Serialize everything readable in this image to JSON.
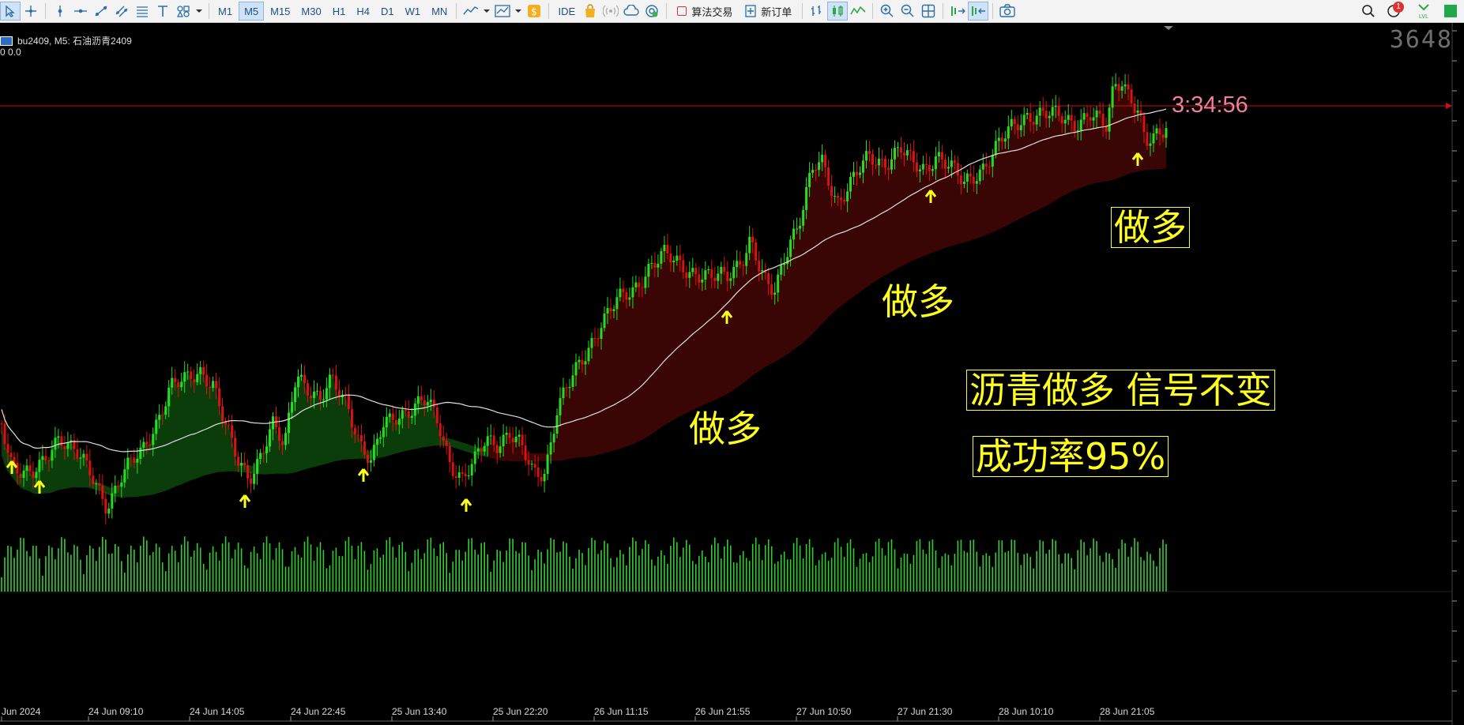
{
  "toolbar": {
    "timeframes": [
      {
        "label": "M1",
        "active": false
      },
      {
        "label": "M5",
        "active": true
      },
      {
        "label": "M15",
        "active": false
      },
      {
        "label": "M30",
        "active": false
      },
      {
        "label": "H1",
        "active": false
      },
      {
        "label": "H4",
        "active": false
      },
      {
        "label": "D1",
        "active": false
      },
      {
        "label": "W1",
        "active": false
      },
      {
        "label": "MN",
        "active": false
      }
    ],
    "ide_label": "IDE",
    "algo_trading_label": "算法交易",
    "new_order_label": "新订单",
    "notification_count": "1",
    "accent_color": "#2b6ea8"
  },
  "chart": {
    "symbol_title": "bu2409, M5:  石油沥青2409",
    "ohlc_line": "0  0.0",
    "watermark": "3648",
    "countdown": "3:34:56",
    "time_labels": [
      "Jun 2024",
      "24 Jun 09:10",
      "24 Jun 14:05",
      "24 Jun 22:45",
      "25 Jun 13:40",
      "25 Jun 22:20",
      "26 Jun 11:15",
      "26 Jun 21:55",
      "27 Jun 10:50",
      "27 Jun 21:30",
      "28 Jun 10:10",
      "28 Jun 21:05"
    ],
    "annotations": [
      {
        "text": "做多",
        "boxed": false
      },
      {
        "text": "做多",
        "boxed": false
      },
      {
        "text": "做多",
        "boxed": true
      },
      {
        "text": "沥青做多 信号不变",
        "boxed": true
      },
      {
        "text": "成功率95%",
        "boxed": true
      }
    ],
    "colors": {
      "background": "#000000",
      "bull": "#22dd22",
      "bear": "#dd1111",
      "volume": "#33cc33",
      "price_line": "#cc1111",
      "ma_line": "#e0e0e0",
      "band_green": "#0b3d0b",
      "band_red": "#3a0505",
      "signal_arrow": "#ffff1e",
      "annotation": "#ffff1e",
      "countdown": "#f08099"
    }
  }
}
